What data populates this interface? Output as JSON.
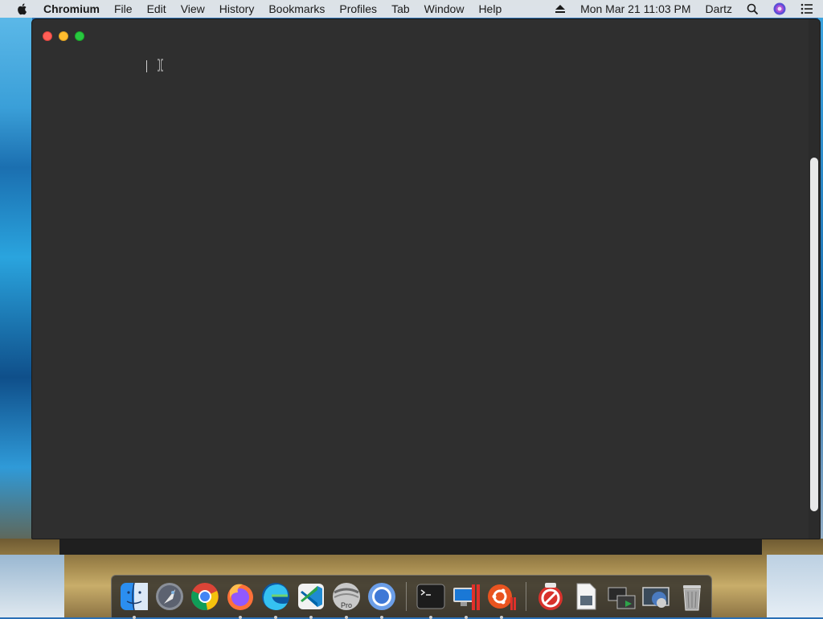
{
  "menubar": {
    "app_name": "Chromium",
    "items": [
      "File",
      "Edit",
      "View",
      "History",
      "Bookmarks",
      "Profiles",
      "Tab",
      "Window",
      "Help"
    ],
    "datetime": "Mon Mar 21  11:03 PM",
    "user": "Dartz"
  },
  "window": {
    "title": ""
  },
  "dock": {
    "apps": [
      {
        "icon": "finder-icon",
        "running": true
      },
      {
        "icon": "launchpad-icon",
        "running": false
      },
      {
        "icon": "chrome-icon",
        "running": false
      },
      {
        "icon": "firefox-icon",
        "running": true
      },
      {
        "icon": "edge-icon",
        "running": true
      },
      {
        "icon": "vscode-icon",
        "running": true
      },
      {
        "icon": "sketchup-pro-icon",
        "running": true,
        "badge": "Pro"
      },
      {
        "icon": "chromium-icon",
        "running": true
      },
      {
        "icon": "terminal-icon",
        "running": true
      },
      {
        "icon": "parallels-windows-icon",
        "running": true
      },
      {
        "icon": "parallels-ubuntu-icon",
        "running": true
      },
      {
        "icon": "no-entry-icon",
        "running": false
      },
      {
        "icon": "preview-icon",
        "running": false
      },
      {
        "icon": "downloads-stack-icon",
        "running": false
      },
      {
        "icon": "screen-stack-icon",
        "running": false
      },
      {
        "icon": "trash-icon",
        "running": false
      }
    ]
  },
  "colors": {
    "window_bg": "#2f2f2f",
    "close": "#fe5f57",
    "minimize": "#febc2e",
    "maximize": "#28c840"
  }
}
